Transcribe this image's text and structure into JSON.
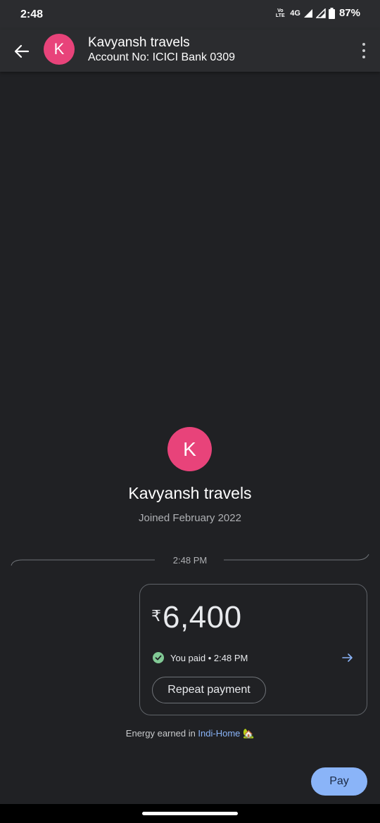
{
  "status_bar": {
    "time": "2:48",
    "volte_top": "Vo",
    "volte_bottom": "LTE",
    "network": "4G",
    "battery": "87%"
  },
  "header": {
    "avatar_letter": "K",
    "name": "Kavyansh travels",
    "account": "Account No: ICICI Bank 0309",
    "back_icon": "arrow-left-icon",
    "menu_icon": "more-vert-icon"
  },
  "profile": {
    "avatar_letter": "K",
    "name": "Kavyansh travels",
    "joined": "Joined February 2022"
  },
  "timeline": {
    "time": "2:48 PM"
  },
  "payment": {
    "currency": "₹",
    "amount": "6,400",
    "status": "You paid • 2:48 PM",
    "repeat_label": "Repeat payment"
  },
  "energy": {
    "prefix": "Energy earned in ",
    "link": "Indi-Home",
    "emoji": "🏡"
  },
  "actions": {
    "pay_label": "Pay"
  },
  "colors": {
    "background": "#202124",
    "app_bar": "#2b2c2f",
    "avatar": "#e8437a",
    "accent": "#8ab4f8",
    "success": "#81c995"
  }
}
